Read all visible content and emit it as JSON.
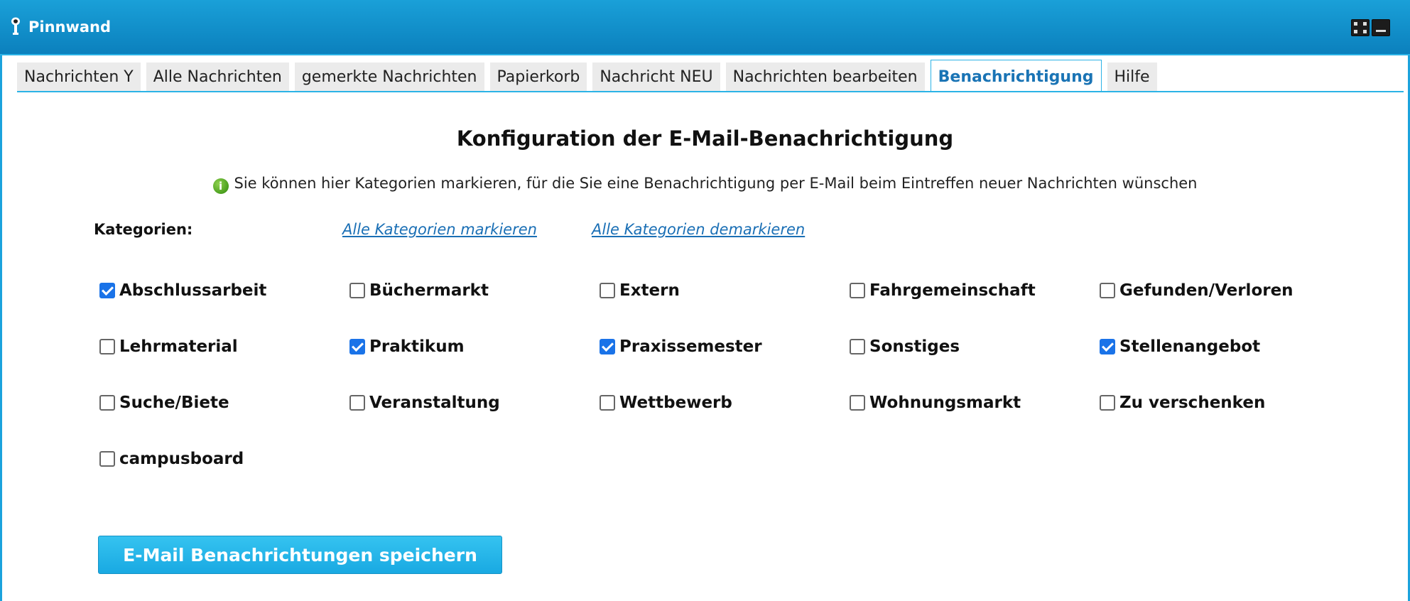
{
  "window": {
    "title": "Pinnwand",
    "icons": {
      "app": "pin-icon",
      "maximize": "maximize-icon",
      "minimize": "minimize-icon"
    },
    "accent_color": "#0b80bd"
  },
  "tabs": [
    {
      "label": "Nachrichten Y",
      "active": false
    },
    {
      "label": "Alle Nachrichten",
      "active": false
    },
    {
      "label": "gemerkte Nachrichten",
      "active": false
    },
    {
      "label": "Papierkorb",
      "active": false
    },
    {
      "label": "Nachricht NEU",
      "active": false
    },
    {
      "label": "Nachrichten bearbeiten",
      "active": false
    },
    {
      "label": "Benachrichtigung",
      "active": true
    },
    {
      "label": "Hilfe",
      "active": false
    }
  ],
  "main": {
    "heading": "Konfiguration der E-Mail-Benachrichtigung",
    "info_icon": "info-icon",
    "info_text": "Sie können hier Kategorien markieren, für die Sie eine Benachrichtigung per E-Mail beim Eintreffen neuer Nachrichten wünschen",
    "categories_label": "Kategorien:",
    "mark_all_link": "Alle Kategorien markieren",
    "unmark_all_link": "Alle Kategorien demarkieren",
    "categories": [
      {
        "label": "Abschlussarbeit",
        "checked": true
      },
      {
        "label": "Büchermarkt",
        "checked": false
      },
      {
        "label": "Extern",
        "checked": false
      },
      {
        "label": "Fahrgemeinschaft",
        "checked": false
      },
      {
        "label": "Gefunden/Verloren",
        "checked": false
      },
      {
        "label": "Lehrmaterial",
        "checked": false
      },
      {
        "label": "Praktikum",
        "checked": true
      },
      {
        "label": "Praxissemester",
        "checked": true
      },
      {
        "label": "Sonstiges",
        "checked": false
      },
      {
        "label": "Stellenangebot",
        "checked": true
      },
      {
        "label": "Suche/Biete",
        "checked": false
      },
      {
        "label": "Veranstaltung",
        "checked": false
      },
      {
        "label": "Wettbewerb",
        "checked": false
      },
      {
        "label": "Wohnungsmarkt",
        "checked": false
      },
      {
        "label": "Zu verschenken",
        "checked": false
      },
      {
        "label": "campusboard",
        "checked": false
      }
    ],
    "save_button": "E-Mail Benachrichtungen speichern"
  }
}
